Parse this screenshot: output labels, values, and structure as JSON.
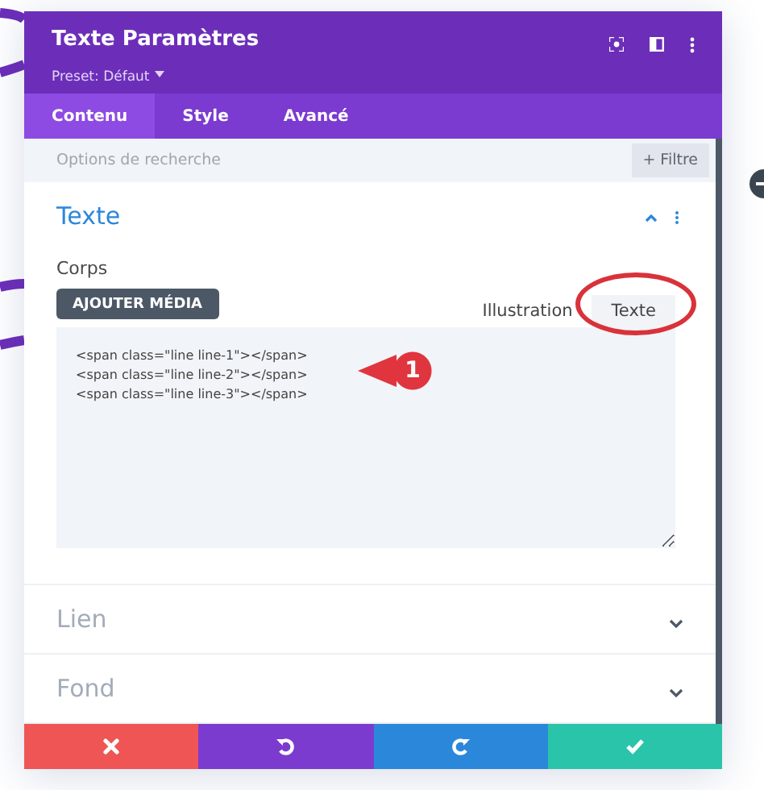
{
  "window": {
    "title": "Texte Paramètres",
    "preset": "Preset: Défaut"
  },
  "tabs": [
    {
      "label": "Contenu",
      "selected": true
    },
    {
      "label": "Style",
      "selected": false
    },
    {
      "label": "Avancé",
      "selected": false
    }
  ],
  "search": {
    "placeholder": "Options de recherche",
    "filter_button": "+ Filtre"
  },
  "sections": [
    {
      "title": "Texte",
      "expanded": true,
      "field_label": "Corps",
      "add_media": "AJOUTER MÉDIA",
      "editor_tabs": [
        {
          "label": "Illustration",
          "selected": false
        },
        {
          "label": "Texte",
          "selected": true
        }
      ],
      "content": "<span class=\"line line-1\"></span>\n<span class=\"line line-2\"></span>\n<span class=\"line line-3\"></span>"
    },
    {
      "title": "Lien",
      "expanded": false
    },
    {
      "title": "Fond",
      "expanded": false
    }
  ],
  "footer_buttons": [
    {
      "kind": "cancel"
    },
    {
      "kind": "undo"
    },
    {
      "kind": "redo"
    },
    {
      "kind": "save"
    }
  ],
  "annotation": {
    "marker": "1"
  }
}
